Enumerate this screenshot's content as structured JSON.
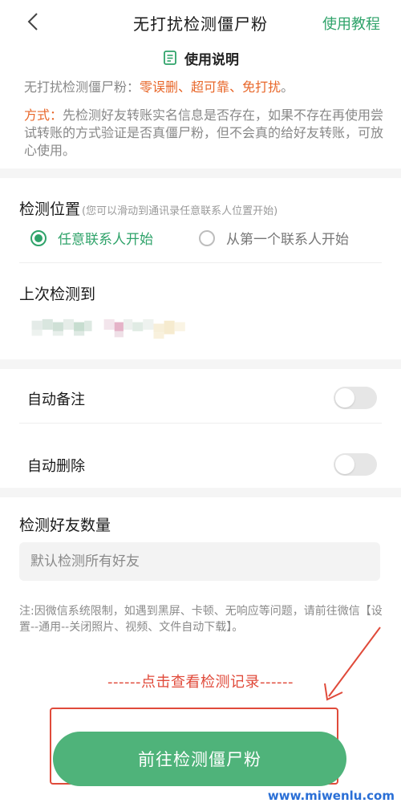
{
  "header": {
    "title": "无打扰检测僵尸粉",
    "tutorial_link": "使用教程",
    "back_icon": "chevron-left-icon"
  },
  "instructions": {
    "heading": "使用说明",
    "summary_prefix": "无打扰检测僵尸粉：",
    "feature_1": "零误删",
    "sep_1": "、",
    "feature_2": "超可靠",
    "sep_2": "、",
    "feature_3": "免打扰",
    "end": "。",
    "method_label": "方式：",
    "method_text": "先检测好友转账实名信息是否存在，如果不存在再使用尝试转账的方式验证是否真僵尸粉，但不会真的给好友转账，可放心使用。"
  },
  "detect_position": {
    "title": "检测位置",
    "hint": "(您可以滑动到通讯录任意联系人位置开始)",
    "options": [
      {
        "label": "任意联系人开始",
        "selected": true
      },
      {
        "label": "从第一个联系人开始",
        "selected": false
      }
    ]
  },
  "last_detected": {
    "title": "上次检测到"
  },
  "toggles": {
    "auto_remark": {
      "label": "自动备注",
      "on": false
    },
    "auto_delete": {
      "label": "自动删除",
      "on": false
    }
  },
  "friend_count": {
    "title": "检测好友数量",
    "placeholder": "默认检测所有好友"
  },
  "note": "注:因微信系统限制，如遇到黑屏、卡顿、无响应等问题，请前往微信【设置--通用--关闭照片、视频、文件自动下载】。",
  "annotation": "------点击查看检测记录------",
  "main_button": "前往检测僵尸粉",
  "watermark": "www.miwenlu.com",
  "colors": {
    "accent_green": "#2fa36a",
    "button_green": "#4fb37a",
    "accent_orange": "#e8672a",
    "annotation_red": "#e04a3a"
  }
}
